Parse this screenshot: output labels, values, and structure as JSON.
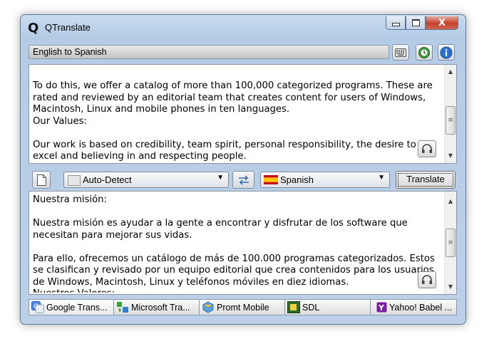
{
  "window": {
    "logo": "Q",
    "title": "QTranslate",
    "close_glyph": "X"
  },
  "toolbar": {
    "direction": "English to Spanish",
    "icons": [
      "keyboard-icon",
      "history-icon",
      "info-icon"
    ]
  },
  "source": {
    "text": "To do this, we offer a catalog of more than 100,000 categorized programs. These are rated and reviewed by an editorial team that creates content for users of Windows, Macintosh, Linux and mobile phones in ten languages.\nOur Values:\n\nOur work is based on credibility, team spirit, personal responsibility, the desire to excel and believing in and respecting people."
  },
  "controls": {
    "from_language": "Auto-Detect",
    "to_language": "Spanish",
    "translate_label": "Translate"
  },
  "result": {
    "text": "Nuestra misión:\n\nNuestra misión es ayudar a la gente a encontrar y disfrutar de los software que necesitan para mejorar sus vidas.\n\nPara ello, ofrecemos un catálogo de más de 100.000 programas categorizados. Estos se clasifican y revisado por un equipo editorial que crea contenidos para los usuarios de Windows, Macintosh, Linux y teléfonos móviles en diez idiomas.\nNuestros Valores:"
  },
  "services": [
    {
      "label": "Google Trans...",
      "icon": "google-translate-icon"
    },
    {
      "label": "Microsoft Tra...",
      "icon": "microsoft-translator-icon"
    },
    {
      "label": "Promt Mobile",
      "icon": "promt-icon"
    },
    {
      "label": "SDL",
      "icon": "sdl-icon"
    },
    {
      "label": "Yahoo! Babel ...",
      "icon": "yahoo-icon"
    }
  ],
  "colors": {
    "window_frame": "#b5cce6",
    "close_button": "#c3412b",
    "info_button": "#2a6fd1"
  }
}
